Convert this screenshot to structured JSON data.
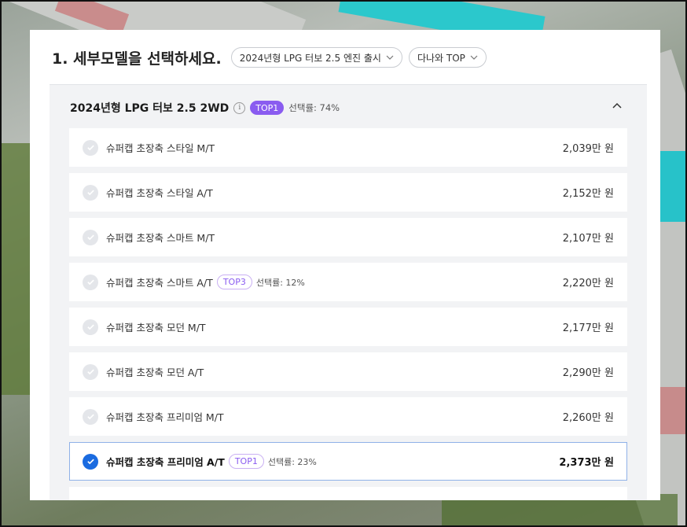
{
  "header": {
    "title": "1. 세부모델을 선택하세요.",
    "filter_model": "2024년형 LPG 터보 2.5 엔진 출시",
    "filter_sort": "다나와 TOP"
  },
  "group": {
    "name": "2024년형 LPG 터보 2.5 2WD",
    "info": "i",
    "badge": "TOP1",
    "rate": "선택률: 74%"
  },
  "items": [
    {
      "label": "슈퍼캡 초장축 스타일 M/T",
      "price": "2,039만 원"
    },
    {
      "label": "슈퍼캡 초장축 스타일 A/T",
      "price": "2,152만 원"
    },
    {
      "label": "슈퍼캡 초장축 스마트 M/T",
      "price": "2,107만 원"
    },
    {
      "label": "슈퍼캡 초장축 스마트 A/T",
      "tag": "TOP3",
      "rate": "선택률: 12%",
      "price": "2,220만 원"
    },
    {
      "label": "슈퍼캡 초장축 모던 M/T",
      "price": "2,177만 원"
    },
    {
      "label": "슈퍼캡 초장축 모던 A/T",
      "price": "2,290만 원"
    },
    {
      "label": "슈퍼캡 초장축 프리미엄 M/T",
      "price": "2,260만 원"
    },
    {
      "label": "슈퍼캡 초장축 프리미엄 A/T",
      "tag": "TOP1",
      "rate": "선택률: 23%",
      "price": "2,373만 원",
      "selected": true
    }
  ],
  "colors": {
    "accent_blue": "#1a6be0",
    "badge_purple": "#8a5cf0"
  },
  "icons": {
    "check": "check-icon",
    "collapse": "chevron-up-icon",
    "dropdown": "chevron-down-icon"
  }
}
